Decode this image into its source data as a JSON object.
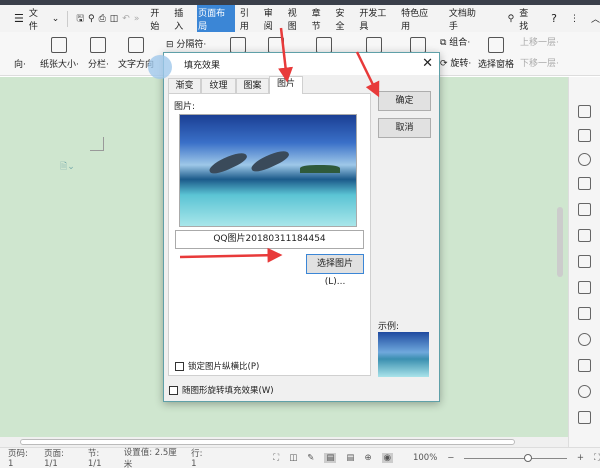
{
  "menubar": {
    "file": "文件",
    "tabs": [
      "开始",
      "插入",
      "页面布局",
      "引用",
      "审阅",
      "视图",
      "章节",
      "安全",
      "开发工具",
      "特色应用",
      "文档助手"
    ],
    "active_tab": "页面布局",
    "search": "查找",
    "help": "?"
  },
  "toolbar": {
    "orientation": "向",
    "paper_size": "纸张大小",
    "columns": "分栏",
    "text_direction": "文字方向",
    "separator": "分隔符",
    "group": "组合",
    "rotate": "旋转",
    "select_pane": "选择窗格",
    "bring_forward": "上移一层",
    "send_backward": "下移一层"
  },
  "dialog": {
    "title": "填充效果",
    "close": "✕",
    "tabs": [
      "渐变",
      "纹理",
      "图案",
      "图片"
    ],
    "active_tab": "图片",
    "picture_label": "图片:",
    "filename": "QQ图片20180311184454",
    "select_button": "选择图片(L)...",
    "lock_aspect": "锁定图片纵横比(P)",
    "rotate_with_shape": "随图形旋转填充效果(W)",
    "ok": "确定",
    "cancel": "取消",
    "sample_label": "示例:"
  },
  "status": {
    "page_num": "页码: 1",
    "page": "页面: 1/1",
    "section": "节: 1/1",
    "setting": "设置值: 2.5厘米",
    "row": "行: 1",
    "zoom": "100%",
    "zoom_level": 100
  },
  "colors": {
    "accent": "#3b86d6",
    "doc_bg": "#cfe6cf",
    "arrow": "#e83a3a"
  }
}
